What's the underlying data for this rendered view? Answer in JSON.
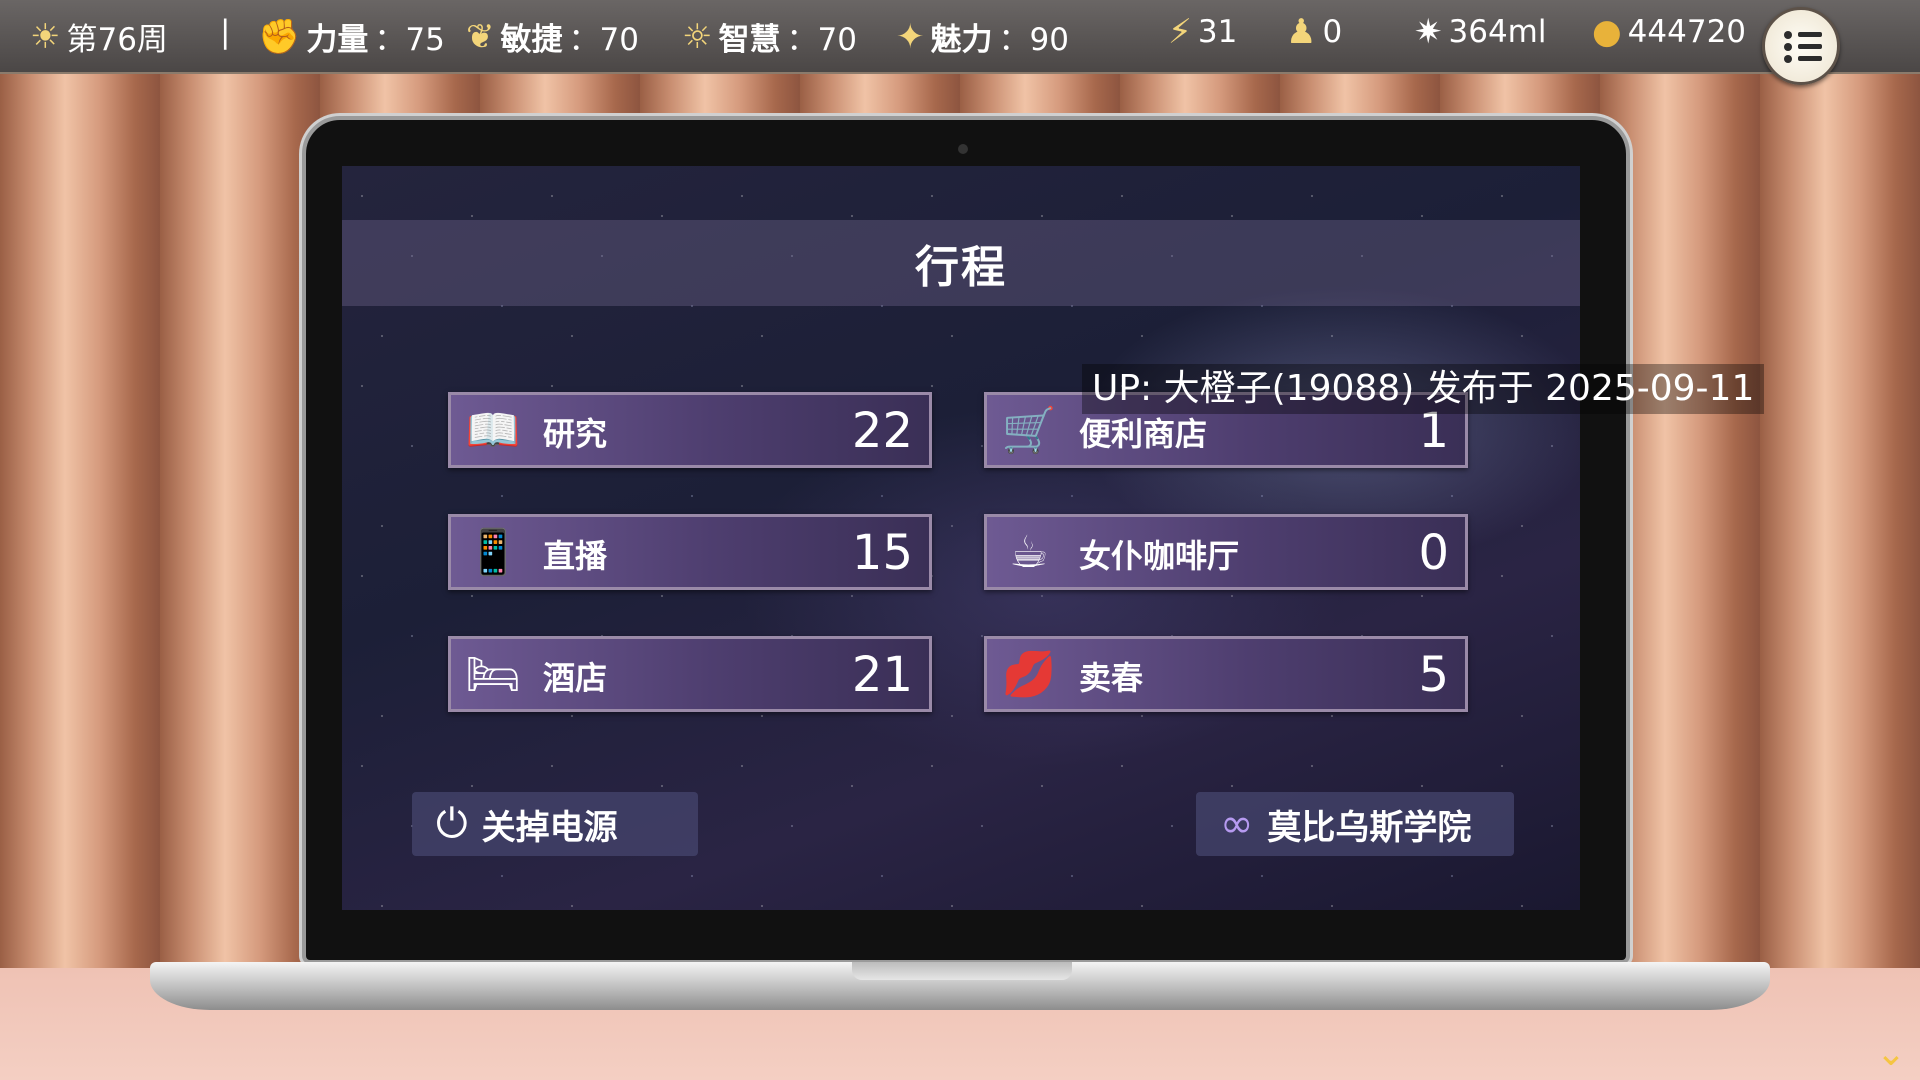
{
  "hud": {
    "week": "第76周",
    "separator": "|",
    "strength_label": "力量",
    "strength_value": "：75",
    "agility_label": "敏捷",
    "agility_value": "：70",
    "wisdom_label": "智慧",
    "wisdom_value": "：70",
    "charm_label": "魅力",
    "charm_value": "：90",
    "energy": "31",
    "stock": "0",
    "liquid": "364ml",
    "money": "444720",
    "icons": {
      "week": "sun-icon",
      "strength": "fist-icon",
      "agility": "feather-icon",
      "wisdom": "lightbulb-icon",
      "charm": "sparkle-icon",
      "energy": "lightning-icon",
      "stock": "figure-icon",
      "liquid": "splash-icon",
      "money": "coin-icon",
      "menu": "list-menu-icon"
    }
  },
  "screen": {
    "title": "行程",
    "schedule": [
      {
        "label": "研究",
        "count": "22",
        "icon": "book-icon"
      },
      {
        "label": "便利商店",
        "count": "1",
        "icon": "shopping-cart-icon"
      },
      {
        "label": "直播",
        "count": "15",
        "icon": "smartphone-icon"
      },
      {
        "label": "女仆咖啡厅",
        "count": "0",
        "icon": "coffee-cup-icon"
      },
      {
        "label": "酒店",
        "count": "21",
        "icon": "bed-icon"
      },
      {
        "label": "卖春",
        "count": "5",
        "icon": "lips-icon"
      }
    ],
    "power_off": "关掉电源",
    "academy": "莫比乌斯学院"
  },
  "watermark": "UP: 大橙子(19088) 发布于 2025-09-11",
  "colors": {
    "hud_bg": "#555050",
    "button_purple": "#5a4780",
    "screen_bg": "#1f2139"
  }
}
